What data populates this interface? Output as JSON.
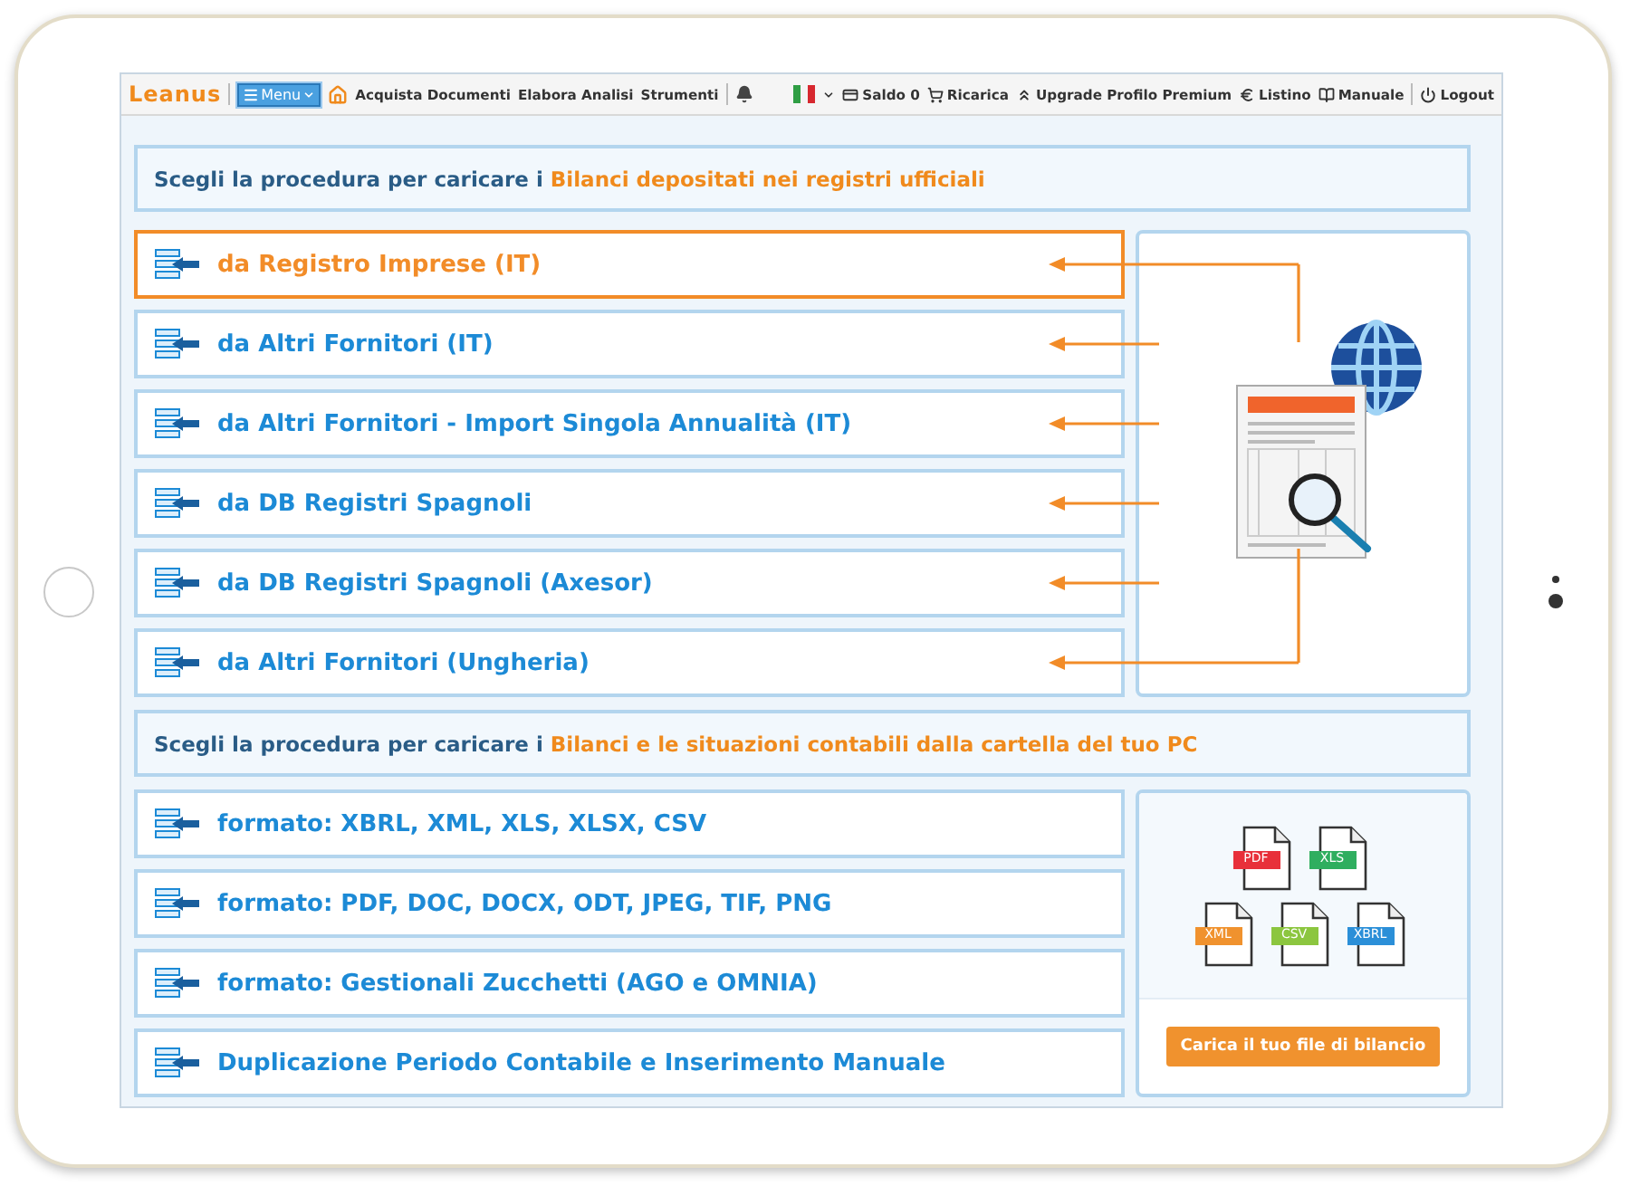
{
  "navbar": {
    "logo": "Leanus",
    "menu_button": "Menu",
    "links": [
      "Acquista Documenti",
      "Elabora Analisi",
      "Strumenti"
    ],
    "actions": [
      {
        "kind": "card",
        "label": "Saldo 0"
      },
      {
        "kind": "cart",
        "label": "Ricarica"
      },
      {
        "kind": "upgrade",
        "label": "Upgrade Profilo Premium"
      },
      {
        "kind": "euro",
        "label": "Listino"
      },
      {
        "kind": "book",
        "label": "Manuale"
      }
    ],
    "logout": "Logout"
  },
  "registry_section": {
    "heading_prefix": "Scegli la procedura per caricare i ",
    "heading_highlight": "Bilanci depositati nei registri ufficiali",
    "options": [
      {
        "label": "da Registro Imprese (IT)",
        "selected": true
      },
      {
        "label": "da Altri Fornitori (IT)",
        "selected": false
      },
      {
        "label": "da Altri Fornitori - Import Singola Annualità (IT)",
        "selected": false
      },
      {
        "label": "da DB Registri Spagnoli",
        "selected": false
      },
      {
        "label": "da DB Registri Spagnoli (Axesor)",
        "selected": false
      },
      {
        "label": "da Altri Fornitori (Ungheria)",
        "selected": false
      }
    ]
  },
  "upload_section": {
    "heading_prefix": "Scegli la procedura per caricare i ",
    "heading_highlight": "Bilanci e le situazioni contabili dalla cartella del tuo PC",
    "options": [
      {
        "label": "formato: XBRL, XML, XLS, XLSX, CSV",
        "selected": false
      },
      {
        "label": "formato: PDF, DOC, DOCX, ODT, JPEG, TIF, PNG",
        "selected": false
      },
      {
        "label": "formato: Gestionali Zucchetti (AGO e OMNIA)",
        "selected": false
      },
      {
        "label": "Duplicazione Periodo Contabile e Inserimento Manuale",
        "selected": false
      }
    ],
    "file_types": [
      {
        "label": "PDF",
        "color": "#e8303a"
      },
      {
        "label": "XLS",
        "color": "#2fae5f"
      },
      {
        "label": "XML",
        "color": "#f0922e"
      },
      {
        "label": "CSV",
        "color": "#8cc63f"
      },
      {
        "label": "XBRL",
        "color": "#2b8fd8"
      }
    ],
    "upload_button": "Carica il tuo file di bilancio"
  }
}
